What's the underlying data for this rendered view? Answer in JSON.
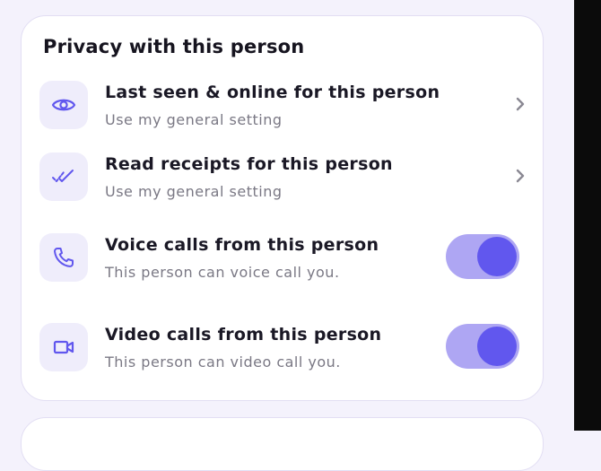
{
  "section": {
    "title": "Privacy with this person",
    "rows": [
      {
        "title": "Last seen & online for this person",
        "subtitle": "Use my general setting",
        "icon": "eye-icon",
        "control": "chevron"
      },
      {
        "title": "Read receipts for this person",
        "subtitle": "Use my general setting",
        "icon": "double-check-icon",
        "control": "chevron"
      },
      {
        "title": "Voice calls from this person",
        "subtitle": "This person can voice call you.",
        "icon": "phone-icon",
        "control": "toggle",
        "enabled": true
      },
      {
        "title": "Video calls from this person",
        "subtitle": "This person can video call you.",
        "icon": "video-camera-icon",
        "control": "toggle",
        "enabled": true
      }
    ]
  },
  "colors": {
    "accent": "#6157ee",
    "toggle_track": "#aea6f3",
    "icon_bg": "#efedfb",
    "background": "#f4f2fc"
  }
}
